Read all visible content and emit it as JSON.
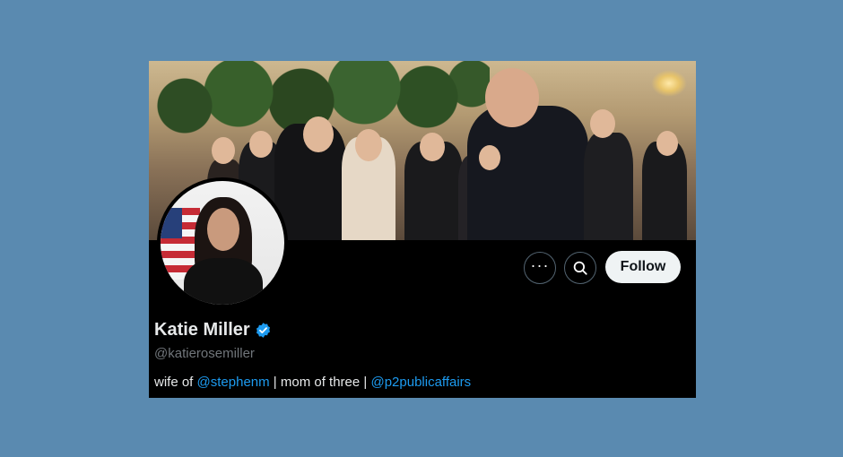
{
  "profile": {
    "display_name": "Katie Miller",
    "handle": "@katierosemiller",
    "verified": true,
    "bio": {
      "prefix": "wife of ",
      "mention1": "@stephenm",
      "middle": " | mom of three | ",
      "mention2": "@p2publicaffairs"
    }
  },
  "actions": {
    "more_icon": "more-icon",
    "search_icon": "search-icon",
    "follow_label": "Follow"
  },
  "colors": {
    "background": "#5a8ab0",
    "card": "#000000",
    "link": "#1d9bf0",
    "verified_badge": "#1d9bf0",
    "follow_bg": "#eff3f4"
  }
}
